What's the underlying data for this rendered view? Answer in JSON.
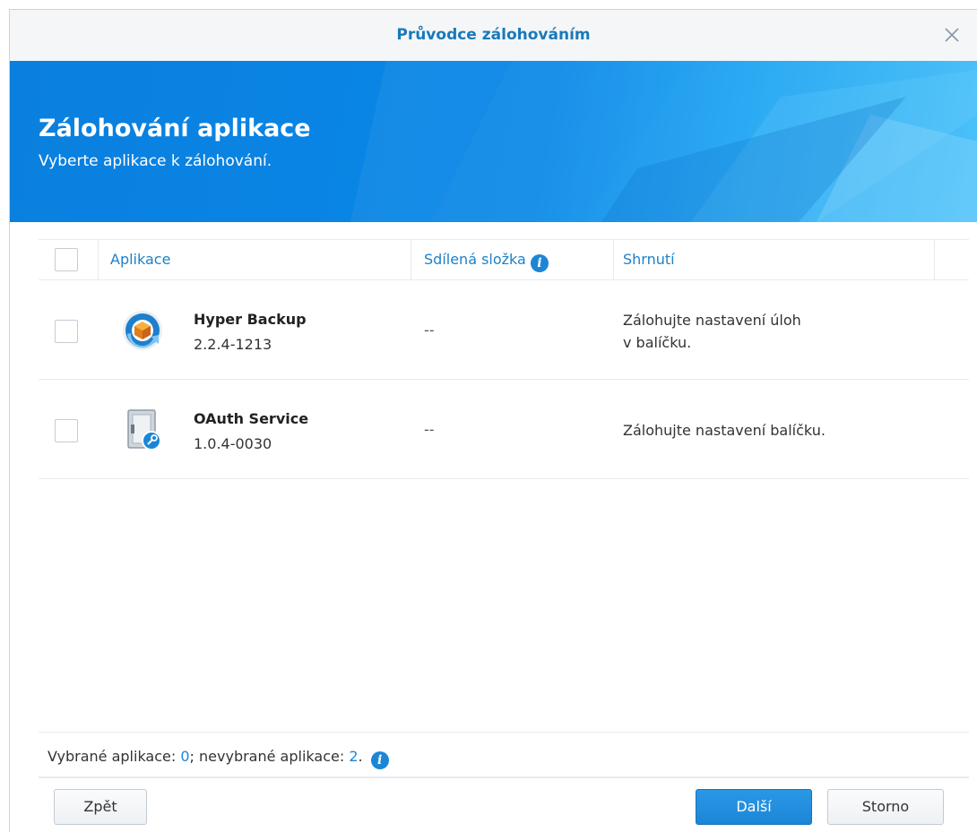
{
  "window": {
    "title": "Průvodce zálohováním"
  },
  "banner": {
    "heading": "Zálohování aplikace",
    "subheading": "Vyberte aplikace k zálohování."
  },
  "table": {
    "columns": {
      "application": "Aplikace",
      "shared_folder": "Sdílená složka",
      "summary": "Shrnutí"
    },
    "rows": [
      {
        "name": "Hyper Backup",
        "version": "2.2.4-1213",
        "shared_folder": "--",
        "summary_line1": "Zálohujte nastavení úloh",
        "summary_line2": "v balíčku.",
        "icon": "hyper-backup-icon",
        "checked": false
      },
      {
        "name": "OAuth Service",
        "version": "1.0.4-0030",
        "shared_folder": "--",
        "summary_line1": "Zálohujte nastavení balíčku.",
        "icon": "oauth-service-icon",
        "checked": false
      }
    ]
  },
  "status": {
    "selected_label": "Vybrané aplikace: ",
    "selected_count": "0",
    "separator": "; nevybrané aplikace: ",
    "unselected_count": "2",
    "end": "."
  },
  "buttons": {
    "back": "Zpět",
    "next": "Další",
    "cancel": "Storno"
  },
  "colors": {
    "accent": "#1c86d6",
    "title": "#1979b9",
    "banner": "#0988e8"
  }
}
